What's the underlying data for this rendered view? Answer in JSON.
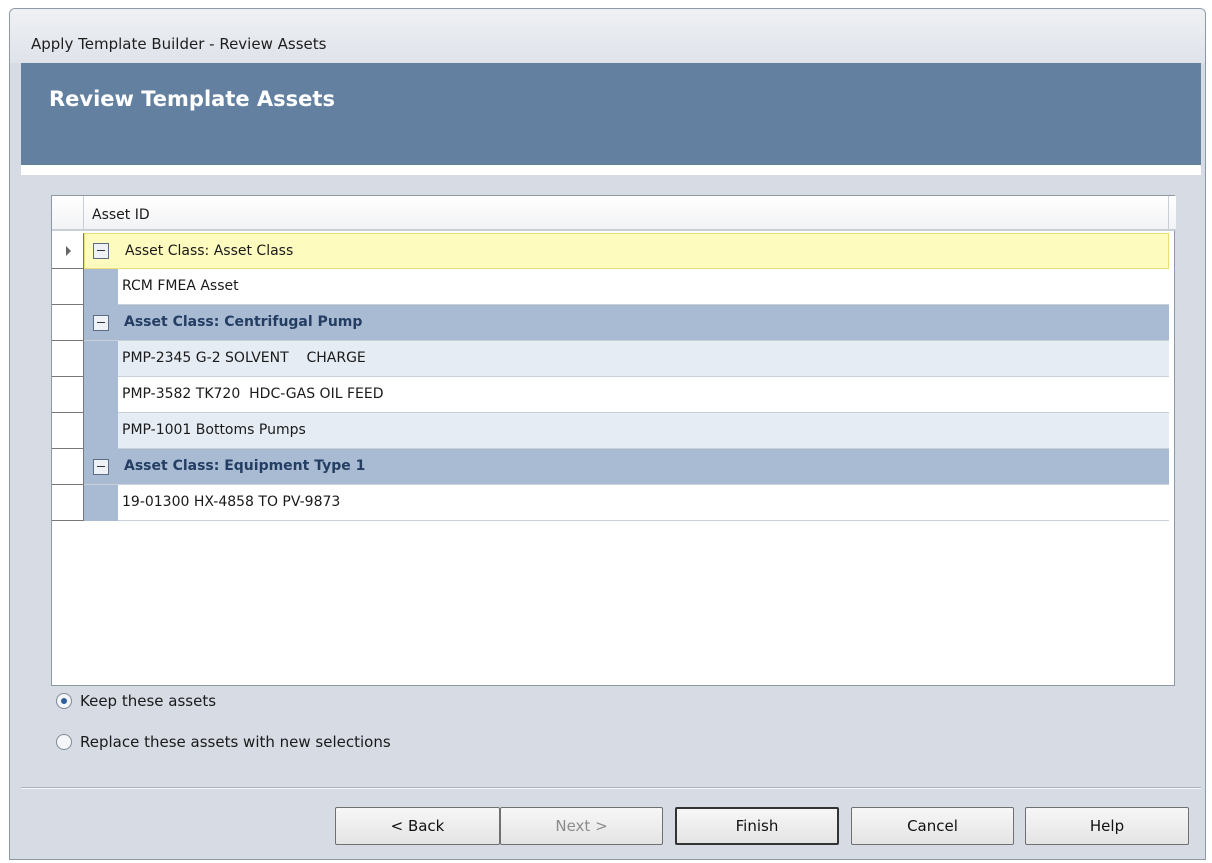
{
  "window": {
    "title": "Apply Template Builder - Review Assets"
  },
  "banner": {
    "heading": "Review Template Assets"
  },
  "grid": {
    "column_header": "Asset ID",
    "rows": [
      {
        "kind": "group",
        "label": "Asset Class: Asset Class",
        "selected": true
      },
      {
        "kind": "data",
        "label": "RCM FMEA Asset"
      },
      {
        "kind": "group",
        "label": "Asset Class: Centrifugal Pump"
      },
      {
        "kind": "data",
        "label": "PMP-2345 G-2 SOLVENT    CHARGE"
      },
      {
        "kind": "data",
        "label": "PMP-3582 TK720  HDC-GAS OIL FEED"
      },
      {
        "kind": "data",
        "label": "PMP-1001 Bottoms Pumps"
      },
      {
        "kind": "group",
        "label": "Asset Class: Equipment Type 1"
      },
      {
        "kind": "data",
        "label": "19-01300 HX-4858 TO PV-9873"
      }
    ]
  },
  "options": {
    "keep": {
      "label": "Keep these assets",
      "checked": true
    },
    "replace": {
      "label": "Replace these assets with new selections",
      "checked": false
    }
  },
  "buttons": {
    "back": "< Back",
    "next": "Next >",
    "finish": "Finish",
    "cancel": "Cancel",
    "help": "Help"
  }
}
